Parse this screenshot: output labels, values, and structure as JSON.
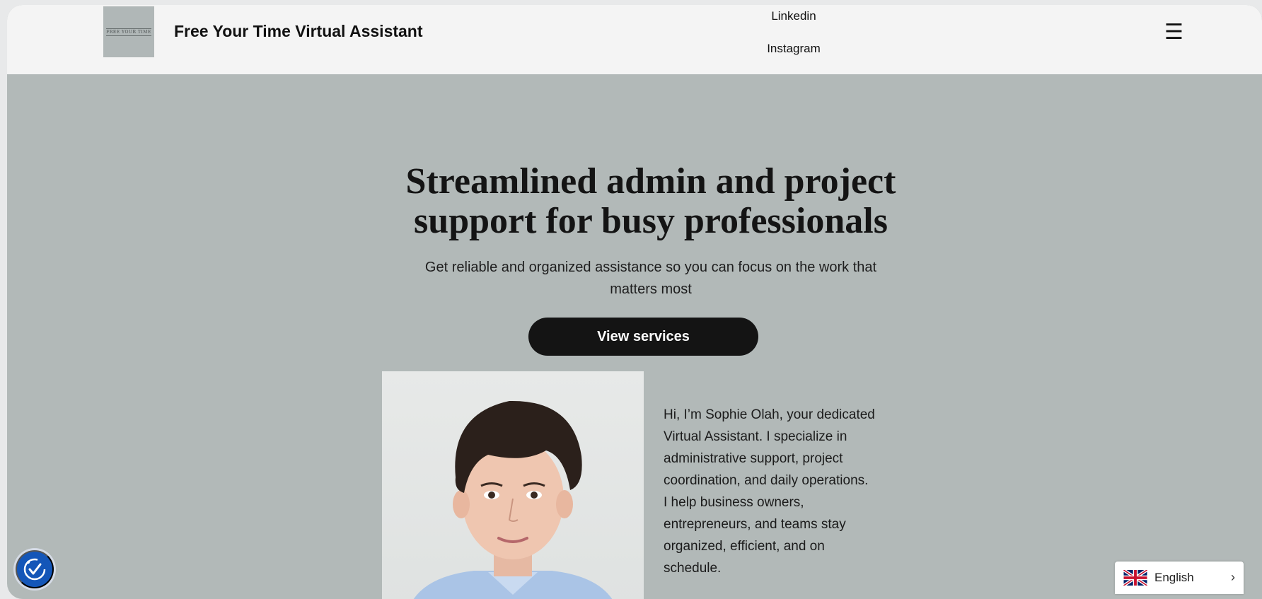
{
  "header": {
    "logo_text": "FREE YOUR TIME",
    "site_title": "Free Your Time Virtual Assistant",
    "nav": [
      {
        "label": "Linkedin"
      },
      {
        "label": "Instagram"
      }
    ],
    "menu_icon": "hamburger-icon"
  },
  "hero": {
    "title": "Streamlined admin and project support for busy professionals",
    "subtitle": "Get reliable and organized assistance so you can focus on the work that matters most",
    "cta_label": "View services"
  },
  "about": {
    "photo_icon": "portrait-photo",
    "bio_paragraphs": [
      "Hi, I’m Sophie Olah, your dedicated Virtual Assistant. I specialize in administrative support, project coordination, and daily operations.",
      "I help business owners, entrepreneurs, and teams stay organized, efficient, and on schedule."
    ]
  },
  "widgets": {
    "accessibility_icon": "accessibility-icon",
    "language_label": "English",
    "language_flag_icon": "uk-flag-icon",
    "language_chevron_icon": "chevron-right-icon"
  },
  "colors": {
    "header_bg": "#f4f4f4",
    "hero_bg": "#b2b9b8",
    "cta_bg": "#141414",
    "accessibility_bg": "#1456b8"
  }
}
